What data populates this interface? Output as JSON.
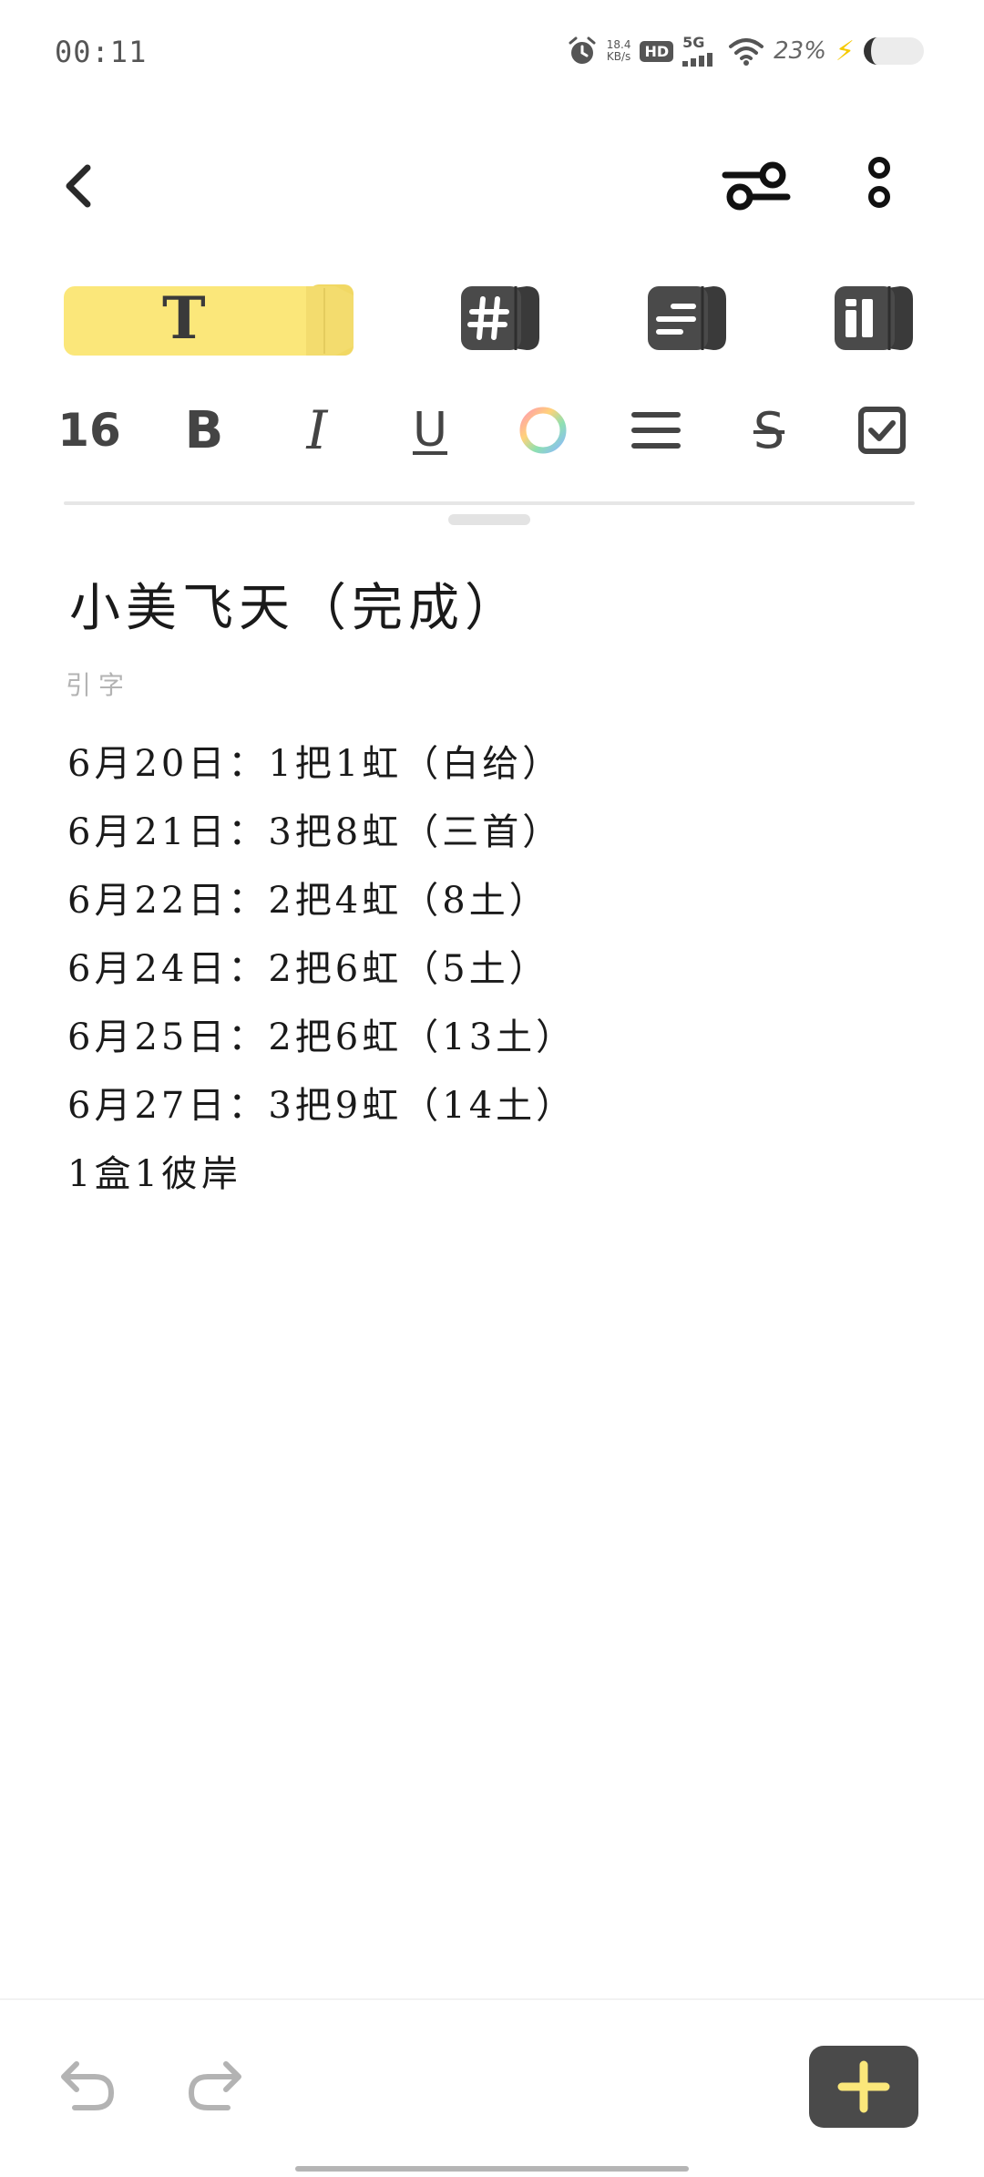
{
  "status_bar": {
    "time": "00:11",
    "net_speed_top": "18.4",
    "net_speed_bottom": "KB/s",
    "hd": "HD",
    "network": "5G",
    "battery": "23%",
    "icons": [
      "alarm-icon",
      "hd-icon",
      "signal-icon",
      "wifi-icon",
      "charging-icon",
      "battery-icon"
    ]
  },
  "toolbar": {
    "icons": [
      "back-icon",
      "settings-toggle-icon",
      "more-icon"
    ]
  },
  "mode_tabs": {
    "text_label": "T",
    "selected": "text",
    "items": [
      "text",
      "tag",
      "list",
      "layout"
    ],
    "accent_color": "#fbe77a",
    "dark_color": "#4a4a4a"
  },
  "format_bar": {
    "size": "16",
    "bold": "B",
    "italic": "I",
    "underline": "U",
    "strike": "S",
    "icons": [
      "color-ring-icon",
      "align-icon",
      "checkbox-icon"
    ]
  },
  "note": {
    "title": "小美飞天（完成）",
    "subtitle": "引字",
    "lines": [
      "6月20日：1把1虹（白给）",
      "6月21日：3把8虹（三首）",
      "6月22日：2把4虹（8土）",
      "6月24日：2把6虹（5土）",
      "6月25日：2把6虹（13土）",
      "6月27日：3把9虹（14土）",
      "1盒1彼岸"
    ]
  },
  "bottom_bar": {
    "icons": [
      "undo-icon",
      "redo-icon",
      "add-icon"
    ],
    "add_color": "#fbe77a"
  }
}
